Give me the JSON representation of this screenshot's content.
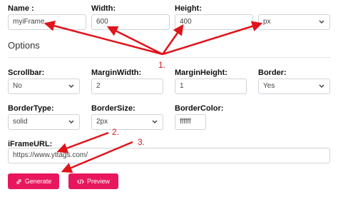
{
  "labels": {
    "name": "Name :",
    "width": "Width:",
    "height": "Height:",
    "scrollbar": "Scrollbar:",
    "margin_width": "MarginWidth:",
    "margin_height": "MarginHeight:",
    "border": "Border:",
    "border_type": "BorderType:",
    "border_size": "BorderSize:",
    "border_color": "BorderColor:",
    "iframe_url": "iFrameURL:"
  },
  "values": {
    "name": "myiFrame",
    "width": "600",
    "height": "400",
    "unit": "px",
    "scrollbar": "No",
    "margin_width": "2",
    "margin_height": "1",
    "border": "Yes",
    "border_type": "solid",
    "border_size": "2px",
    "border_color": "ffffff",
    "iframe_url": "https://www.yttags.com/"
  },
  "section_heading": "Options",
  "buttons": {
    "generate": "Generate",
    "preview": "Preview"
  },
  "annotations": [
    "1.",
    "2.",
    "3."
  ],
  "colors": {
    "button_bg": "#e8175d",
    "annotation": "#e0141b",
    "border": "#ced4da"
  }
}
